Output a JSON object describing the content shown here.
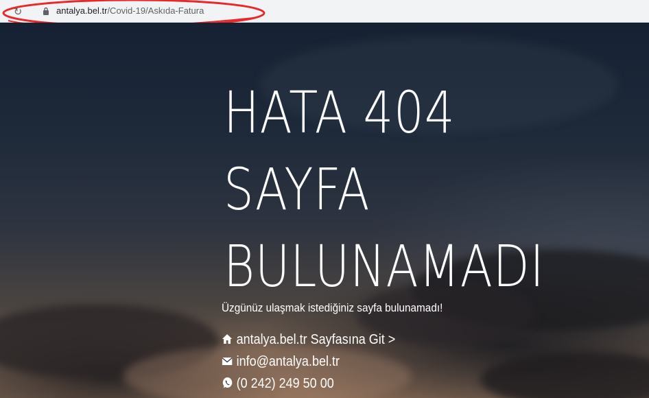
{
  "browser": {
    "url_domain": "antalya.bel.tr",
    "url_path": "/Covid-19/Askıda-Fatura",
    "icons": {
      "reload": "reload-icon",
      "lock": "lock-icon"
    },
    "annotation_color": "#e8282b"
  },
  "page": {
    "headline_lines": [
      "HATA 404",
      "SAYFA",
      "BULUNAMADI"
    ],
    "subtitle": "Üzgünüz ulaşmak istediğiniz sayfa bulunamadı!",
    "links": {
      "home": {
        "label": "antalya.bel.tr Sayfasına Git >",
        "icon": "home-icon"
      },
      "email": {
        "label": "info@antalya.bel.tr",
        "icon": "mail-icon"
      },
      "phone": {
        "label": "(0 242) 249 50 00",
        "icon": "whatsapp-icon"
      }
    },
    "text_color": "#ffffff"
  }
}
